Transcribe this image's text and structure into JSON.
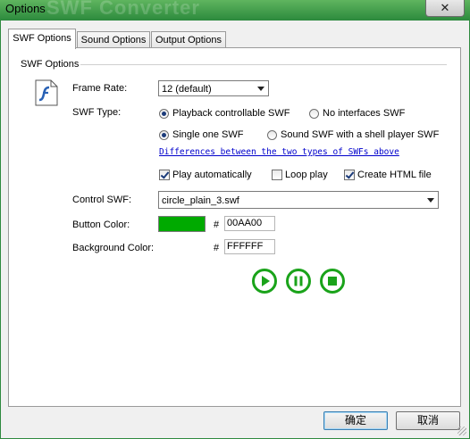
{
  "window": {
    "title": "Options",
    "watermark": "SWF Converter",
    "close_glyph": "✕"
  },
  "tabs": [
    {
      "label": "SWF Options",
      "active": true
    },
    {
      "label": "Sound Options",
      "active": false
    },
    {
      "label": "Output Options",
      "active": false
    }
  ],
  "swf": {
    "group_label": "SWF Options",
    "frame_rate_label": "Frame Rate:",
    "frame_rate_value": "12 (default)",
    "swf_type_label": "SWF Type:",
    "radio_playback": "Playback controllable SWF",
    "radio_no_interfaces": "No interfaces SWF",
    "radio_single": "Single one SWF",
    "radio_shell": "Sound SWF with a shell player SWF",
    "diff_link": "Differences between the two types of SWFs above",
    "check_play_auto": "Play automatically",
    "check_loop": "Loop play",
    "check_html": "Create HTML file",
    "control_swf_label": "Control SWF:",
    "control_swf_value": "circle_plain_3.swf",
    "button_color_label": "Button Color:",
    "button_color_hex": "00AA00",
    "background_color_label": "Background Color:",
    "background_color_hex": "FFFFFF",
    "hash": "#"
  },
  "colors": {
    "button_color": "#00AA00",
    "background_color": "#FFFFFF",
    "preview_green": "#1aa31a"
  },
  "footer": {
    "ok_label": "确定",
    "cancel_label": "取消"
  }
}
